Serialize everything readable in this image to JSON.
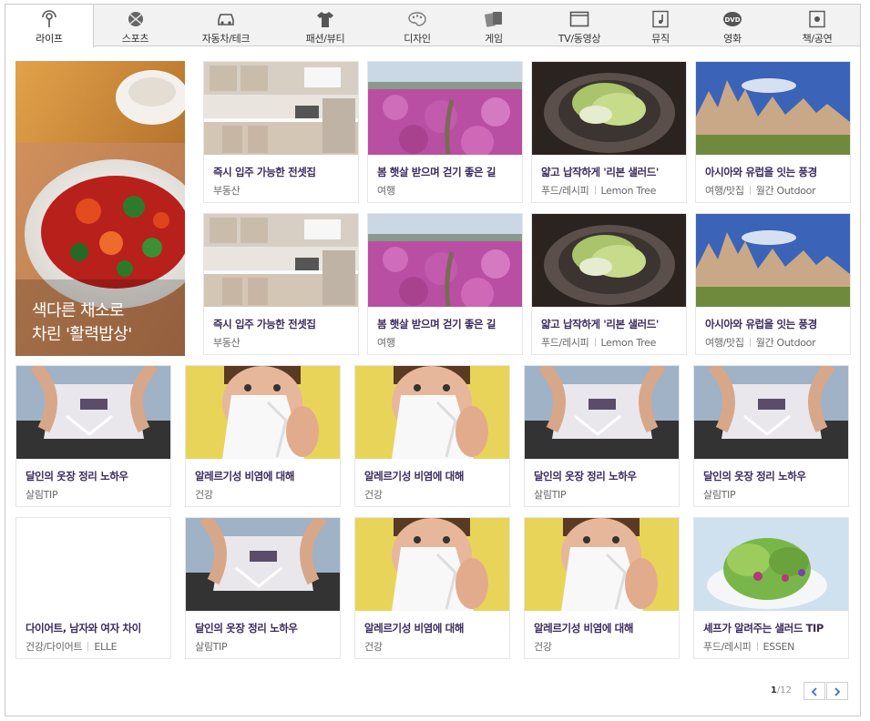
{
  "tabs": [
    {
      "label": "라이프",
      "icon": "life-icon",
      "active": true
    },
    {
      "label": "스포츠",
      "icon": "ball-icon"
    },
    {
      "label": "자동차/테크",
      "icon": "car-icon"
    },
    {
      "label": "패션/뷰티",
      "icon": "shirt-icon"
    },
    {
      "label": "디자인",
      "icon": "palette-icon"
    },
    {
      "label": "게임",
      "icon": "cards-icon"
    },
    {
      "label": "TV/동영상",
      "icon": "tv-icon"
    },
    {
      "label": "뮤직",
      "icon": "music-note-icon"
    },
    {
      "label": "영화",
      "icon": "dvd-icon"
    },
    {
      "label": "책/공연",
      "icon": "book-icon"
    }
  ],
  "feature": {
    "caption_line1": "색다른 채소로",
    "caption_line2": "차린 '활력밥상'"
  },
  "cards": [
    {
      "title": "즉시 입주 가능한 전셋집",
      "category": "부동산",
      "source": "",
      "image": "kitchen"
    },
    {
      "title": "봄 햇살 받으며 걷기 좋은 길",
      "category": "여행",
      "source": "",
      "image": "flowers"
    },
    {
      "title": "얇고 납작하게 '리본 샐러드'",
      "category": "푸드/레시피",
      "source": "Lemon Tree",
      "image": "ribbon"
    },
    {
      "title": "아시아와 유럽을 잇는 풍경",
      "category": "여행/맛집",
      "source": "월간 Outdoor",
      "image": "rocks"
    },
    {
      "title": "즉시 입주 가능한 전셋집",
      "category": "부동산",
      "source": "",
      "image": "kitchen"
    },
    {
      "title": "봄 햇살 받으며 걷기 좋은 길",
      "category": "여행",
      "source": "",
      "image": "flowers"
    },
    {
      "title": "얇고 납작하게 '리본 샐러드'",
      "category": "푸드/레시피",
      "source": "Lemon Tree",
      "image": "ribbon"
    },
    {
      "title": "아시아와 유럽을 잇는 풍경",
      "category": "여행/맛집",
      "source": "월간 Outdoor",
      "image": "rocks"
    },
    {
      "title": "달인의 옷장 정리 노하우",
      "category": "살림TIP",
      "source": "",
      "image": "clothes"
    },
    {
      "title": "알레르기성 비염에 대해",
      "category": "건강",
      "source": "",
      "image": "sneeze"
    },
    {
      "title": "알레르기성 비염에 대해",
      "category": "건강",
      "source": "",
      "image": "sneeze"
    },
    {
      "title": "달인의 옷장 정리 노하우",
      "category": "살림TIP",
      "source": "",
      "image": "clothes"
    },
    {
      "title": "달인의 옷장 정리 노하우",
      "category": "살림TIP",
      "source": "",
      "image": "clothes"
    },
    {
      "title": "다이어트, 남자와 여자 차이",
      "category": "건강/다이어트",
      "source": "ELLE",
      "image": ""
    },
    {
      "title": "달인의 옷장 정리 노하우",
      "category": "살림TIP",
      "source": "",
      "image": "clothes"
    },
    {
      "title": "알레르기성 비염에 대해",
      "category": "건강",
      "source": "",
      "image": "sneeze"
    },
    {
      "title": "알레르기성 비염에 대해",
      "category": "건강",
      "source": "",
      "image": "sneeze"
    },
    {
      "title": "셰프가 알려주는 샐러드 TIP",
      "category": "푸드/레시피",
      "source": "ESSEN",
      "image": "salad"
    }
  ],
  "pager": {
    "current": "1",
    "separator": "/",
    "total": "12",
    "prev_icon": "chevron-left-icon",
    "next_icon": "chevron-right-icon"
  },
  "colors": {
    "title_purple": "#3b2b5e",
    "tab_bg": "#f2f2f2",
    "pager_blue": "#3a6fcf"
  }
}
